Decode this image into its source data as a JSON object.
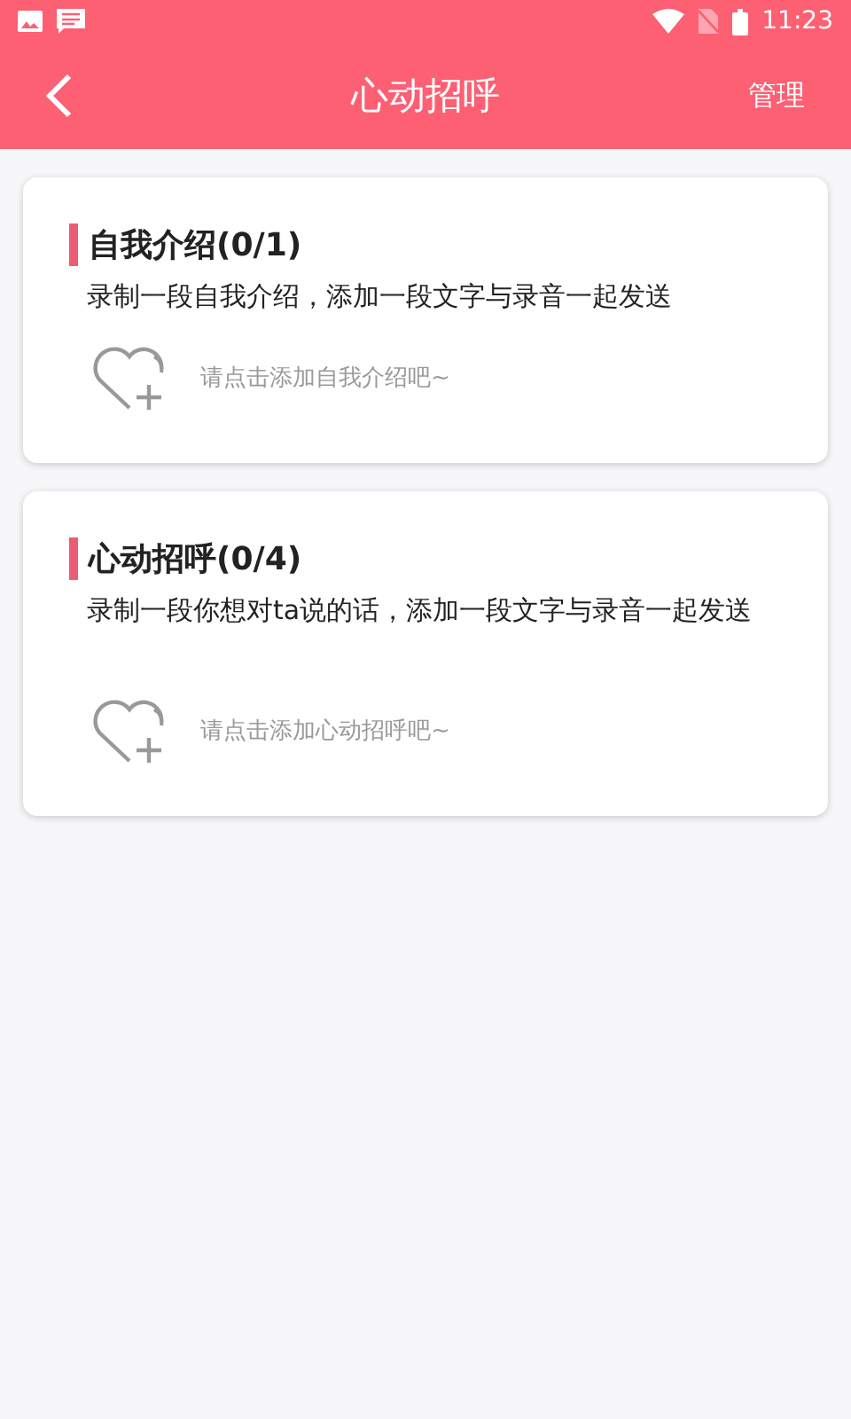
{
  "status_bar": {
    "time": "11:23"
  },
  "toolbar": {
    "title": "心动招呼",
    "action": "管理"
  },
  "cards": [
    {
      "title": "自我介绍(0/1)",
      "description": "录制一段自我介绍，添加一段文字与录音一起发送",
      "hint": "请点击添加自我介绍吧~"
    },
    {
      "title": "心动招呼(0/4)",
      "description": "录制一段你想对ta说的话，添加一段文字与录音一起发送",
      "hint": "请点击添加心动招呼吧~"
    }
  ]
}
